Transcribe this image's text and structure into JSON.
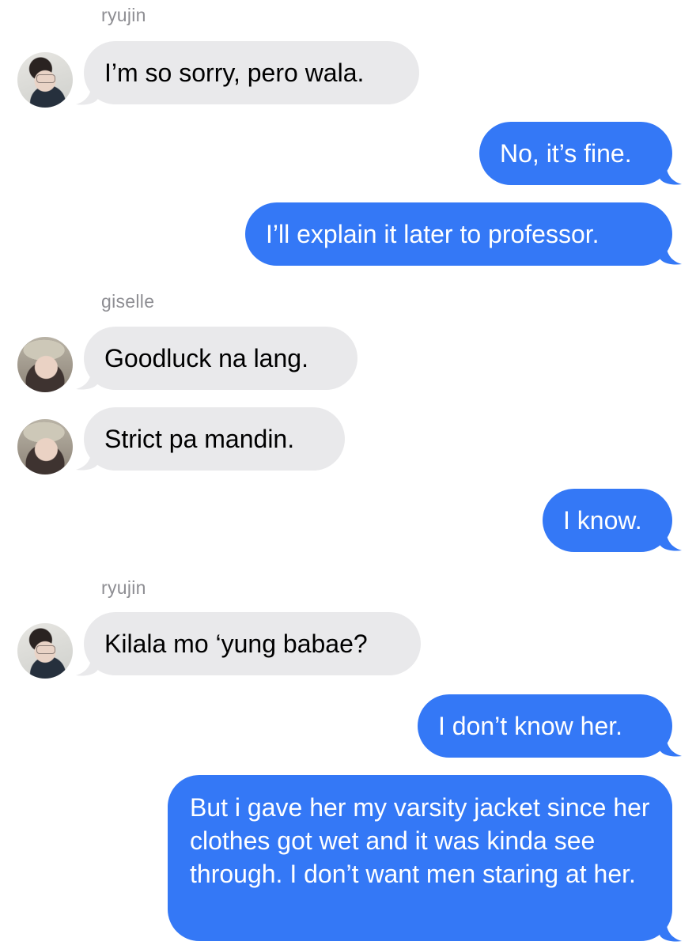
{
  "messages": [
    {
      "type": "sender",
      "name": "ryujin"
    },
    {
      "type": "incoming",
      "text": "I’m so sorry, pero wala.",
      "avatar": "ryujin-avatar"
    },
    {
      "type": "outgoing",
      "text": "No, it’s fine."
    },
    {
      "type": "outgoing",
      "text": "I’ll explain it later to professor."
    },
    {
      "type": "sender",
      "name": "giselle"
    },
    {
      "type": "incoming",
      "text": "Goodluck na lang.",
      "avatar": "giselle-avatar"
    },
    {
      "type": "incoming",
      "text": "Strict pa mandin.",
      "avatar": "giselle-avatar"
    },
    {
      "type": "outgoing",
      "text": "I know."
    },
    {
      "type": "sender",
      "name": "ryujin"
    },
    {
      "type": "incoming",
      "text": "Kilala mo ‘yung babae?",
      "avatar": "ryujin-avatar"
    },
    {
      "type": "outgoing",
      "text": "I don’t know her."
    },
    {
      "type": "outgoing",
      "text": "But i gave her my varsity jacket since her clothes got wet and it was kinda see through. I don’t want men staring at her."
    }
  ],
  "colors": {
    "outgoing_bubble": "#3478f6",
    "incoming_bubble": "#e9e9eb",
    "sender_name": "#8e8e93"
  }
}
